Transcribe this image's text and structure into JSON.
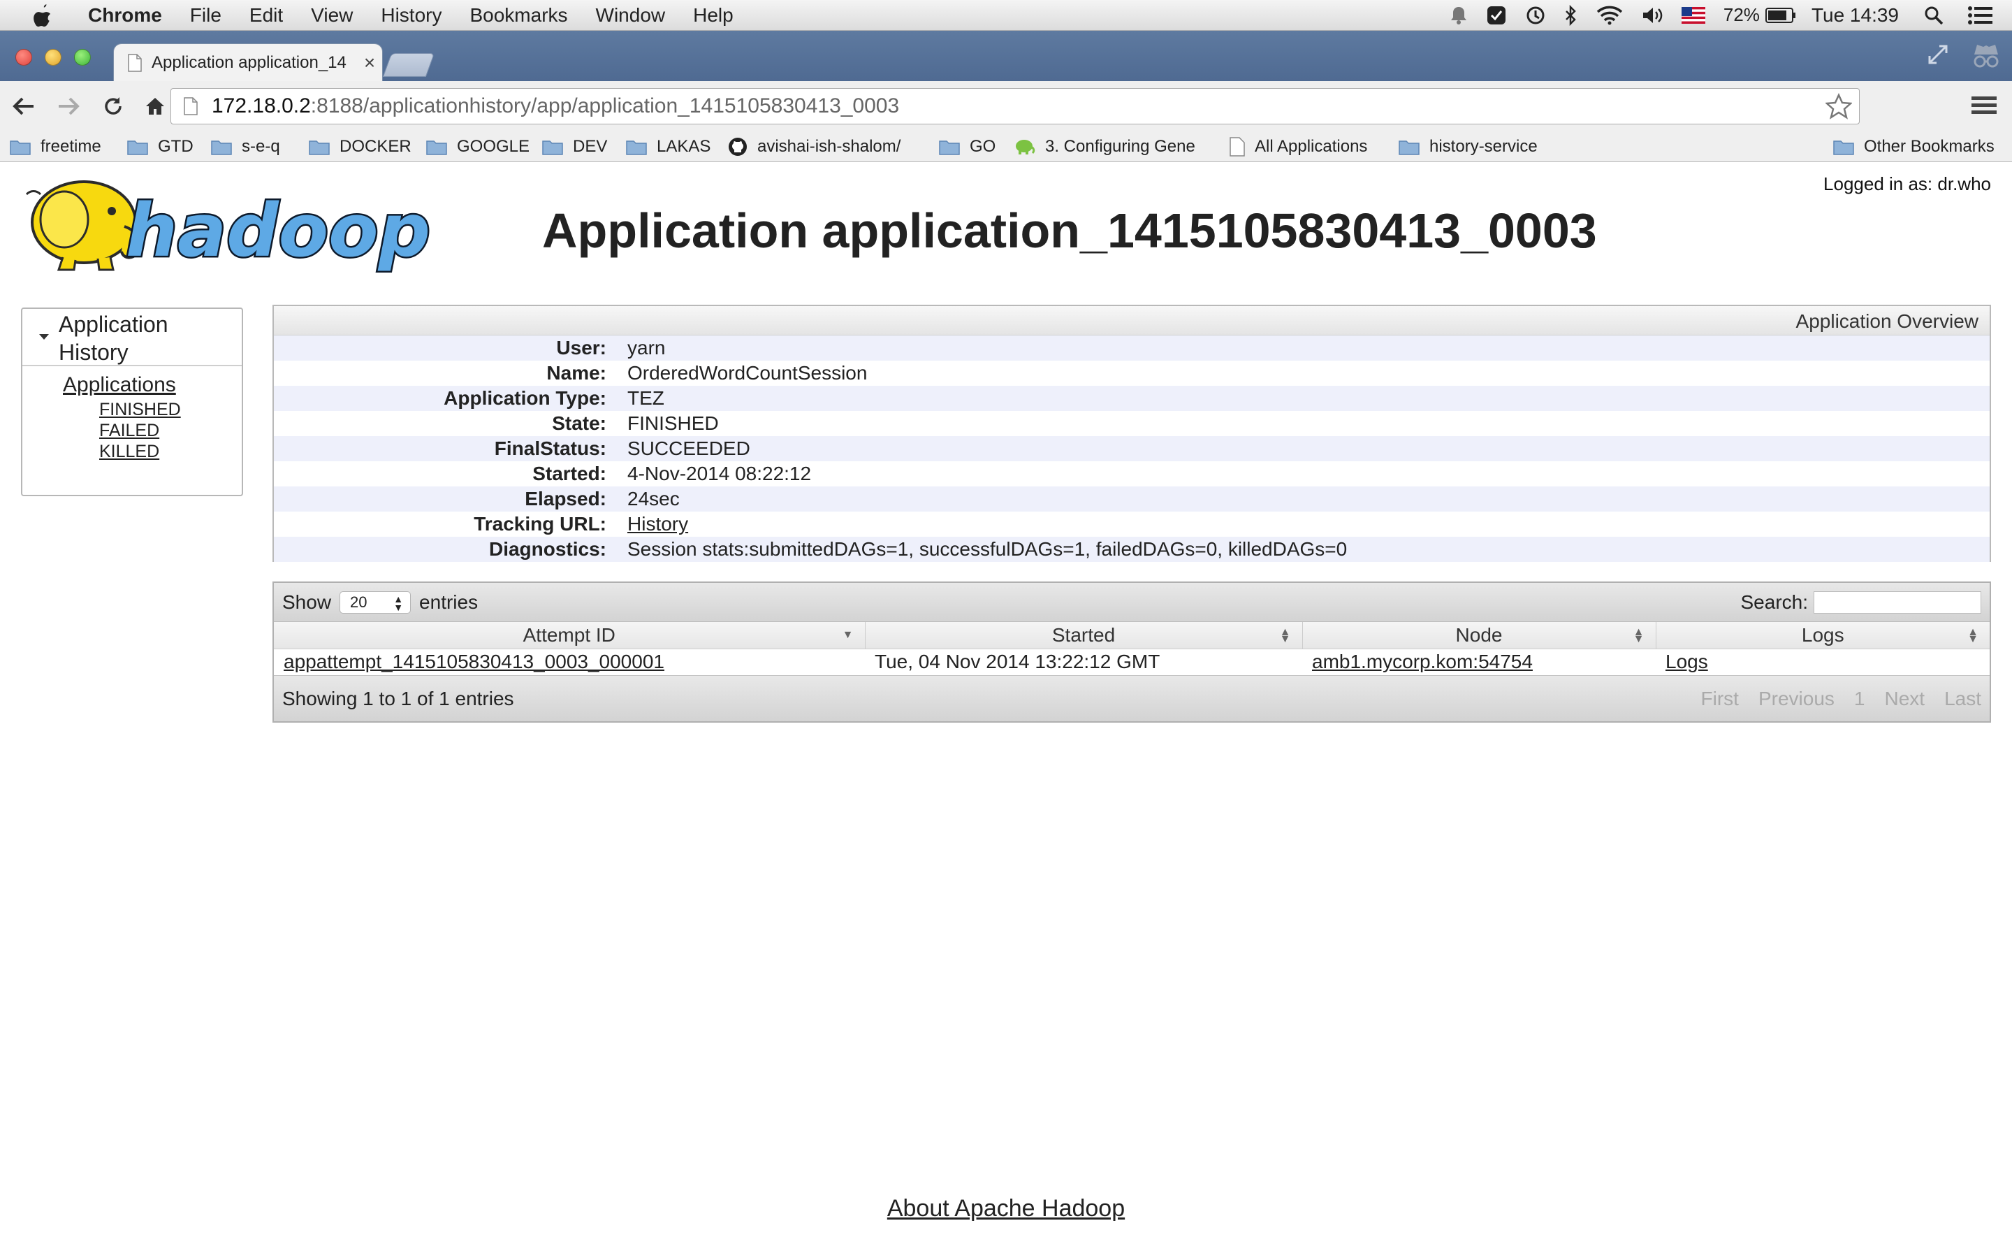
{
  "menubar": {
    "app_name": "Chrome",
    "items": [
      "File",
      "Edit",
      "View",
      "History",
      "Bookmarks",
      "Window",
      "Help"
    ],
    "battery_percent": "72%",
    "clock": "Tue 14:39"
  },
  "browser": {
    "tab_title": "Application application_14",
    "url_host": "172.18.0.2",
    "url_path": ":8188/applicationhistory/app/application_1415105830413_0003"
  },
  "bookmarks": [
    {
      "label": "freetime",
      "icon": "folder-icon"
    },
    {
      "label": "GTD",
      "icon": "folder-icon"
    },
    {
      "label": "s-e-q",
      "icon": "folder-icon"
    },
    {
      "label": "DOCKER",
      "icon": "folder-icon"
    },
    {
      "label": "GOOGLE",
      "icon": "folder-icon"
    },
    {
      "label": "DEV",
      "icon": "folder-icon"
    },
    {
      "label": "LAKAS",
      "icon": "folder-icon"
    },
    {
      "label": "avishai-ish-shalom/",
      "icon": "github-icon"
    },
    {
      "label": "GO",
      "icon": "folder-icon"
    },
    {
      "label": "3. Configuring Gene",
      "icon": "hadoop-elephant-icon"
    },
    {
      "label": "All Applications",
      "icon": "page-icon"
    },
    {
      "label": "history-service",
      "icon": "folder-icon"
    },
    {
      "label": "Other Bookmarks",
      "icon": "folder-icon"
    }
  ],
  "header": {
    "logo_text": "hadoop",
    "logged_in": "Logged in as: dr.who",
    "title": "Application application_1415105830413_0003"
  },
  "sidebar": {
    "section_label": "Application History",
    "applications_link": "Applications",
    "sub_links": [
      "FINISHED",
      "FAILED",
      "KILLED"
    ]
  },
  "overview": {
    "heading": "Application Overview",
    "rows": [
      {
        "label": "User:",
        "value": "yarn"
      },
      {
        "label": "Name:",
        "value": "OrderedWordCountSession"
      },
      {
        "label": "Application Type:",
        "value": "TEZ"
      },
      {
        "label": "State:",
        "value": "FINISHED"
      },
      {
        "label": "FinalStatus:",
        "value": "SUCCEEDED"
      },
      {
        "label": "Started:",
        "value": "4-Nov-2014 08:22:12"
      },
      {
        "label": "Elapsed:",
        "value": "24sec"
      },
      {
        "label": "Tracking URL:",
        "value": "History"
      },
      {
        "label": "Diagnostics:",
        "value": "Session stats:submittedDAGs=1, successfulDAGs=1, failedDAGs=0, killedDAGs=0"
      }
    ]
  },
  "attempts": {
    "show_label": "Show",
    "page_length": "20",
    "entries_label": "entries",
    "search_label": "Search:",
    "columns": [
      "Attempt ID",
      "Started",
      "Node",
      "Logs"
    ],
    "rows": [
      [
        "appattempt_1415105830413_0003_000001",
        "Tue, 04 Nov 2014 13:22:12 GMT",
        "amb1.mycorp.kom:54754",
        "Logs"
      ]
    ],
    "info": "Showing 1 to 1 of 1 entries",
    "pager": [
      "First",
      "Previous",
      "1",
      "Next",
      "Last"
    ]
  },
  "footer": {
    "about_link": "About Apache Hadoop"
  }
}
